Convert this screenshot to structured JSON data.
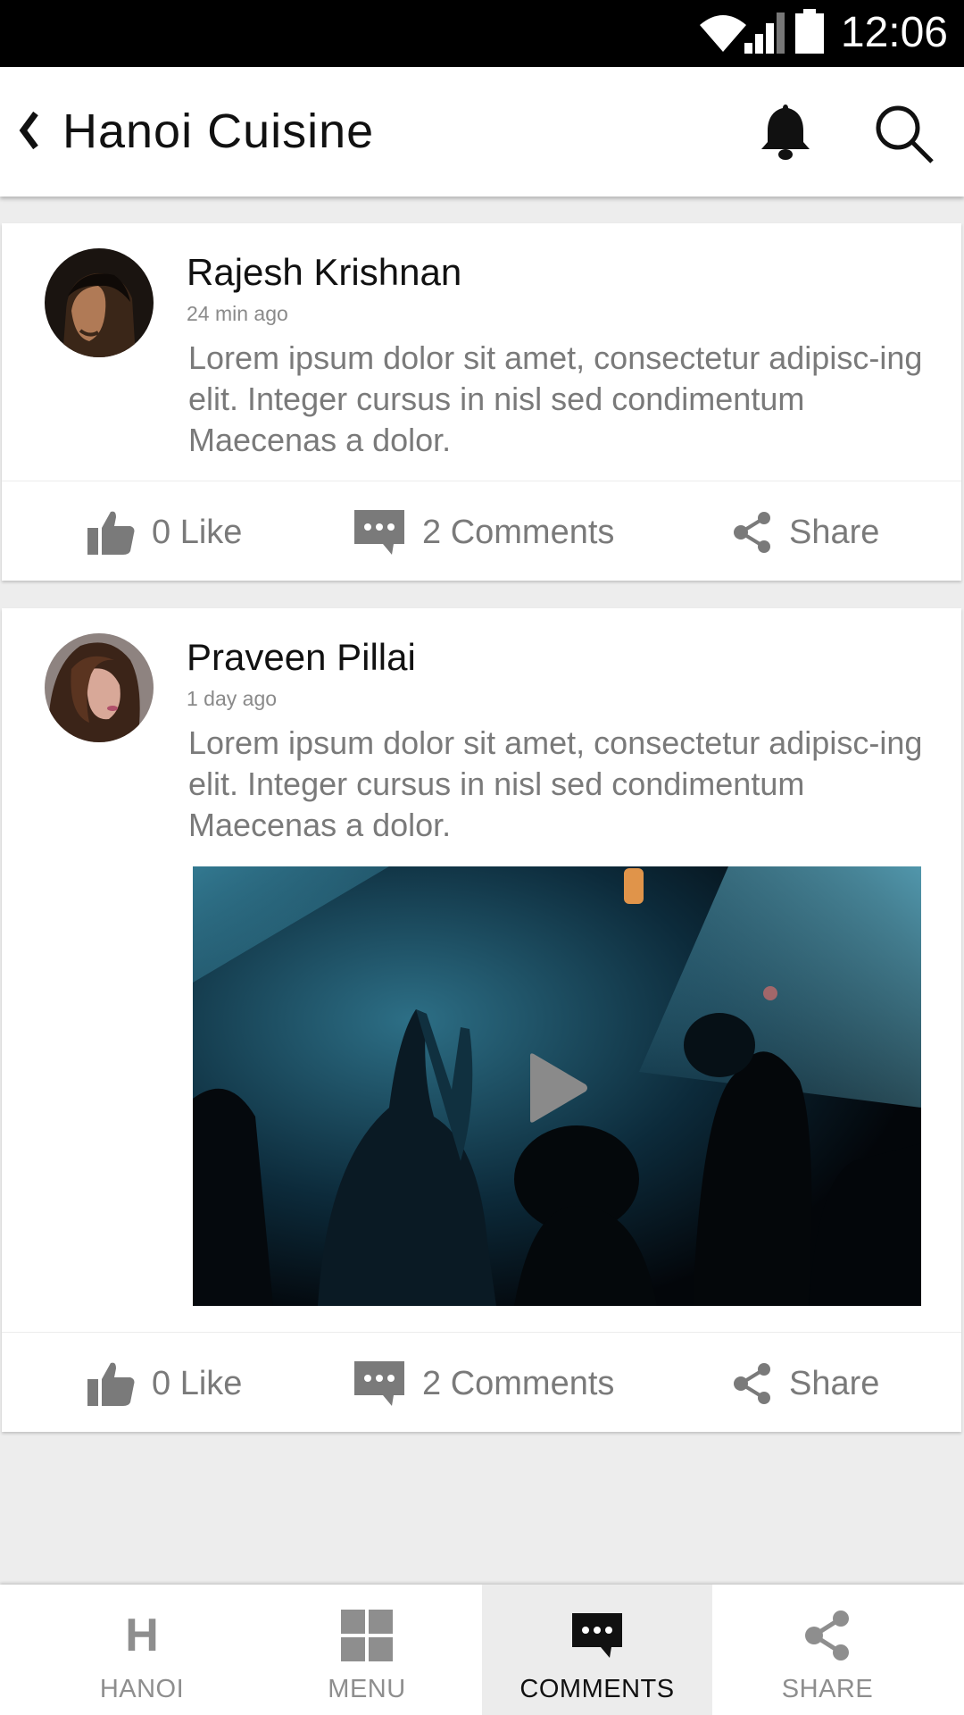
{
  "status_bar": {
    "time": "12:06"
  },
  "app_bar": {
    "title": "Hanoi Cuisine"
  },
  "posts": [
    {
      "author": "Rajesh Krishnan",
      "time_ago": "24 min ago",
      "text": "Lorem ipsum dolor sit amet, consectetur adipisc-ing elit. Integer cursus in nisl sed condimentum Maecenas a dolor.",
      "like_label": "0 Like",
      "comments_label": "2 Comments",
      "share_label": "Share"
    },
    {
      "author": "Praveen Pillai",
      "time_ago": "1 day ago",
      "text": "Lorem ipsum dolor sit amet, consectetur adipisc-ing elit. Integer cursus in nisl sed condimentum Maecenas a dolor.",
      "like_label": "0 Like",
      "comments_label": "2 Comments",
      "share_label": "Share",
      "has_video": true
    }
  ],
  "bottom_nav": {
    "items": [
      {
        "label": "HANOI",
        "icon": "h-letter-icon"
      },
      {
        "label": "MENU",
        "icon": "grid-icon"
      },
      {
        "label": "COMMENTS",
        "icon": "comment-bubble-icon",
        "active": true
      },
      {
        "label": "SHARE",
        "icon": "share-icon"
      }
    ]
  },
  "colors": {
    "text_primary": "#111111",
    "text_secondary": "#7a7a7a",
    "background": "#ededed",
    "active_tab": "#ececec"
  }
}
